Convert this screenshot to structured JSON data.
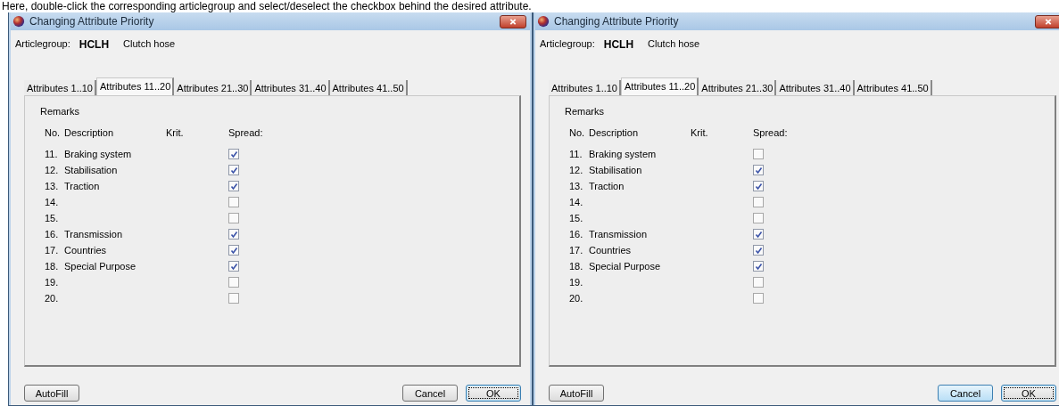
{
  "caption": "Here, double-click the corresponding articlegroup and select/deselect the checkbox behind the desired attribute.",
  "windows": [
    {
      "title": "Changing Attribute Priority",
      "article_label": "Articlegroup:",
      "article_code": "HCLH",
      "article_name": "Clutch hose",
      "tabs": [
        {
          "label": "Attributes 1..10",
          "selected": false
        },
        {
          "label": "Attributes 11..20",
          "selected": true
        },
        {
          "label": "Attributes 21..30",
          "selected": false
        },
        {
          "label": "Attributes 31..40",
          "selected": false
        },
        {
          "label": "Attributes 41..50",
          "selected": false
        }
      ],
      "section_title": "Remarks",
      "columns": [
        "No.",
        "Description",
        "Krit.",
        "Spread:"
      ],
      "rows": [
        {
          "no": "11.",
          "description": "Braking system",
          "checked": true
        },
        {
          "no": "12.",
          "description": "Stabilisation",
          "checked": true
        },
        {
          "no": "13.",
          "description": "Traction",
          "checked": true
        },
        {
          "no": "14.",
          "checked": false
        },
        {
          "no": "15.",
          "checked": false
        },
        {
          "no": "16.",
          "description": "Transmission",
          "checked": true
        },
        {
          "no": "17.",
          "description": "Countries",
          "checked": true
        },
        {
          "no": "18.",
          "description": "Special Purpose",
          "checked": true
        },
        {
          "no": "19.",
          "checked": false
        },
        {
          "no": "20.",
          "checked": false
        }
      ],
      "buttons": [
        {
          "label": "AutoFill",
          "kind": "left",
          "focused": false,
          "hovered": false
        },
        {
          "label": "Cancel",
          "kind": "right",
          "focused": false,
          "hovered": false
        },
        {
          "label": "OK",
          "kind": "right",
          "focused": true,
          "hovered": false
        }
      ]
    },
    {
      "title": "Changing Attribute Priority",
      "article_label": "Articlegroup:",
      "article_code": "HCLH",
      "article_name": "Clutch hose",
      "tabs": [
        {
          "label": "Attributes 1..10",
          "selected": false
        },
        {
          "label": "Attributes 11..20",
          "selected": true
        },
        {
          "label": "Attributes 21..30",
          "selected": false
        },
        {
          "label": "Attributes 31..40",
          "selected": false
        },
        {
          "label": "Attributes 41..50",
          "selected": false
        }
      ],
      "section_title": "Remarks",
      "columns": [
        "No.",
        "Description",
        "Krit.",
        "Spread:"
      ],
      "rows": [
        {
          "no": "11.",
          "description": "Braking system",
          "checked": false
        },
        {
          "no": "12.",
          "description": "Stabilisation",
          "checked": true
        },
        {
          "no": "13.",
          "description": "Traction",
          "checked": true
        },
        {
          "no": "14.",
          "checked": false
        },
        {
          "no": "15.",
          "checked": false
        },
        {
          "no": "16.",
          "description": "Transmission",
          "checked": true
        },
        {
          "no": "17.",
          "description": "Countries",
          "checked": true
        },
        {
          "no": "18.",
          "description": "Special Purpose",
          "checked": true
        },
        {
          "no": "19.",
          "checked": false
        },
        {
          "no": "20.",
          "checked": false
        }
      ],
      "buttons": [
        {
          "label": "AutoFill",
          "kind": "left",
          "focused": false,
          "hovered": false
        },
        {
          "label": "Cancel",
          "kind": "right",
          "focused": false,
          "hovered": true
        },
        {
          "label": "OK",
          "kind": "right",
          "focused": true,
          "hovered": false
        }
      ]
    }
  ]
}
